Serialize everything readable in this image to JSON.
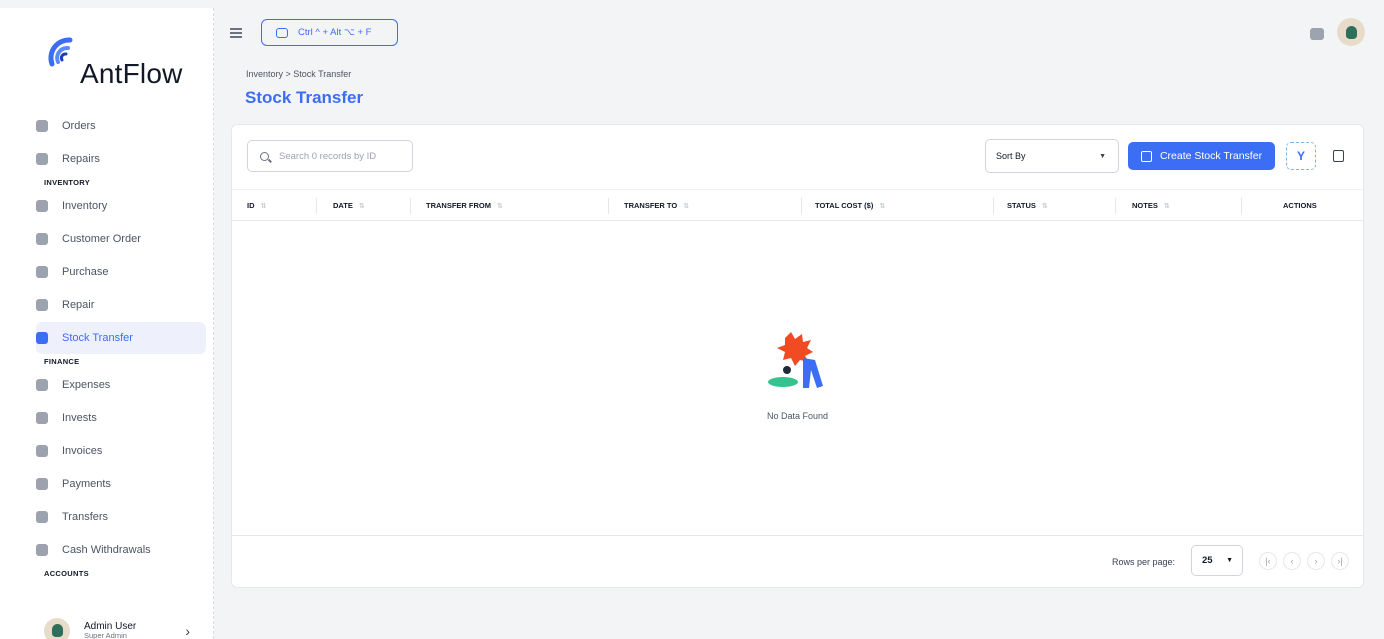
{
  "brand": {
    "name": "AntFlow",
    "accent": "#3b6ef5"
  },
  "sidebar": {
    "top_items": [
      {
        "label": "Orders",
        "icon": "orders-icon"
      },
      {
        "label": "Repairs",
        "icon": "repairs-icon"
      }
    ],
    "sections": [
      {
        "title": "INVENTORY",
        "items": [
          {
            "label": "Inventory",
            "icon": "inventory-icon"
          },
          {
            "label": "Customer Order",
            "icon": "customer-order-icon"
          },
          {
            "label": "Purchase",
            "icon": "purchase-icon"
          },
          {
            "label": "Repair",
            "icon": "repair-icon"
          },
          {
            "label": "Stock Transfer",
            "icon": "stock-transfer-icon",
            "active": true
          }
        ]
      },
      {
        "title": "FINANCE",
        "items": [
          {
            "label": "Expenses",
            "icon": "expenses-icon"
          },
          {
            "label": "Invests",
            "icon": "invests-icon"
          },
          {
            "label": "Invoices",
            "icon": "invoices-icon"
          },
          {
            "label": "Payments",
            "icon": "payments-icon"
          },
          {
            "label": "Transfers",
            "icon": "transfers-icon"
          },
          {
            "label": "Cash Withdrawals",
            "icon": "cash-withdrawals-icon"
          }
        ]
      },
      {
        "title": "ACCOUNTS",
        "items": []
      }
    ],
    "user": {
      "name": "Admin User",
      "role": "Super Admin"
    }
  },
  "topbar": {
    "shortcut": "Ctrl ^ + Alt ⌥ + F"
  },
  "breadcrumb": "Inventory > Stock Transfer",
  "page_title": "Stock Transfer",
  "toolbar": {
    "search_placeholder": "Search 0 records by ID",
    "sort_label": "Sort By",
    "create_label": "Create Stock Transfer"
  },
  "table": {
    "columns": [
      "ID",
      "DATE",
      "TRANSFER FROM",
      "TRANSFER TO",
      "TOTAL COST ($)",
      "STATUS",
      "NOTES",
      "ACTIONS"
    ],
    "rows": [],
    "empty_text": "No Data Found"
  },
  "pagination": {
    "rows_per_page_label": "Rows per page:",
    "rows_per_page": "25"
  }
}
